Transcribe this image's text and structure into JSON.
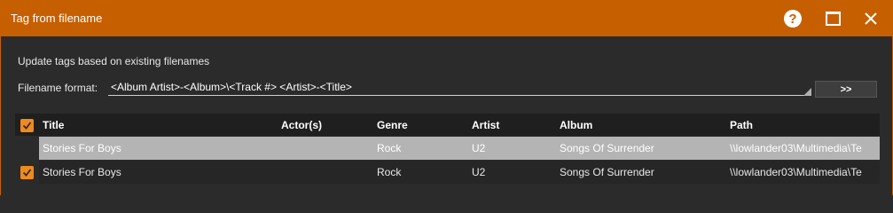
{
  "window": {
    "title": "Tag from filename",
    "help_glyph": "?",
    "accent_color": "#c65f00",
    "icons": [
      "help-icon",
      "maximize-icon",
      "close-icon"
    ]
  },
  "form": {
    "description": "Update tags based on existing filenames",
    "format_label": "Filename format:",
    "format_value": "<Album Artist>-<Album>\\<Track #> <Artist>-<Title>",
    "go_button_label": ">>"
  },
  "table": {
    "columns": [
      "Title",
      "Actor(s)",
      "Genre",
      "Artist",
      "Album",
      "Path"
    ],
    "header_checked": true,
    "rows": [
      {
        "checked": false,
        "selected": true,
        "title": "Stories For Boys",
        "actors": "",
        "genre": "Rock",
        "artist": "U2",
        "album": "Songs Of Surrender",
        "path": "\\\\lowlander03\\Multimedia\\Te"
      },
      {
        "checked": true,
        "selected": false,
        "title": "Stories For Boys",
        "actors": "",
        "genre": "Rock",
        "artist": "U2",
        "album": "Songs Of Surrender",
        "path": "\\\\lowlander03\\Multimedia\\Te"
      }
    ]
  }
}
